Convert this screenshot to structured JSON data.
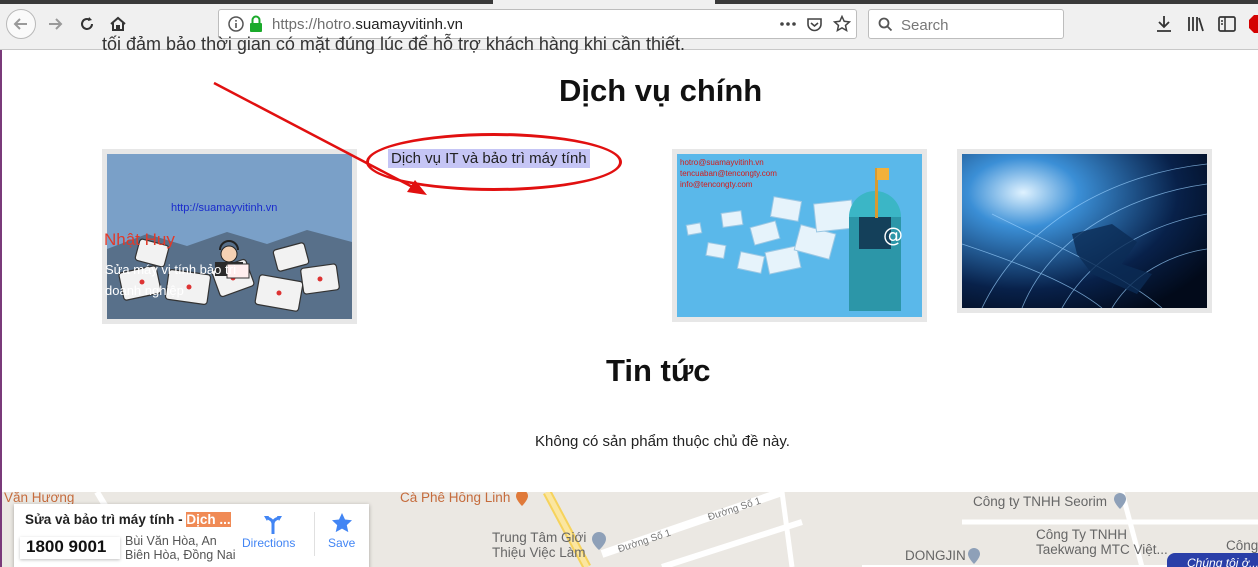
{
  "browser": {
    "url_scheme": "https://hotro.",
    "url_domain": "suamayvitinh.vn",
    "search_placeholder": "Search",
    "icons": [
      "back-icon",
      "forward-icon",
      "reload-icon",
      "home-icon",
      "info-icon",
      "lock-icon",
      "page-actions-icon",
      "pocket-icon",
      "bookmark-star-icon",
      "search-icon",
      "download-icon",
      "library-icon",
      "sidebar-icon",
      "adblock-icon"
    ]
  },
  "page": {
    "cut_text": "tối đảm bảo thời gian có mặt đúng lúc để hỗ trợ khách hàng khi cần thiết.",
    "services_heading": "Dịch vụ chính",
    "annotated_caption": "Dịch vụ IT và bảo trì máy tính",
    "card1": {
      "url_text": "http://suamayvitinh.vn",
      "name": "Nhật Huy",
      "subtitle": "Sửa máy vi tính bảo trì doanh nghiệp"
    },
    "card3": {
      "emails": [
        "hotro@suamayvitinh.vn",
        "tencuaban@tencongty.com",
        "info@tencongty.com"
      ]
    },
    "news_heading": "Tin tức",
    "news_notice": "Không có sản phẩm thuộc chủ đề này."
  },
  "map": {
    "labels": [
      "Văn Hương",
      "Cà Phê Hồng Linh",
      "Công ty TNHH Seorim",
      "Trung Tâm Giới Thiệu Việc Làm",
      "Đường Số 1",
      "Đường Số 1",
      "Công Ty TNHH Taekwang MTC Việt...",
      "DONGJIN",
      "Công"
    ],
    "info_title": "Sửa và bảo trì máy tính - ",
    "info_title_highlight": "Dịch ...",
    "info_phone": "1800 9001",
    "info_address_1": "Bùi Văn Hòa, An",
    "info_address_2": "Biên Hòa, Đồng Nai",
    "directions_label": "Directions",
    "save_label": "Save",
    "chip_label": "Chúng tôi ở..."
  },
  "colors": {
    "accent_red": "#e11010",
    "highlight": "#c5c5f5",
    "map_bg": "#ebe8e3",
    "google_blue": "#4285f4"
  }
}
